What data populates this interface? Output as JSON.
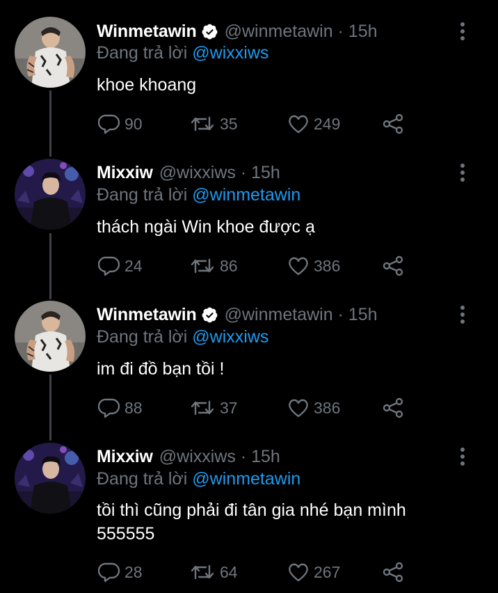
{
  "colors": {
    "background": "#000000",
    "text": "#ffffff",
    "secondary": "#6e767d",
    "link": "#1d9bf0",
    "verified": "#ffffff",
    "thread_line": "#3d4046"
  },
  "icons": {
    "reply": "reply-icon",
    "retweet": "retweet-icon",
    "like": "heart-icon",
    "share": "share-icon",
    "more": "more-vertical-icon",
    "verified": "verified-badge-icon"
  },
  "tweets": [
    {
      "name": "Winmetawin",
      "verified": true,
      "handle": "@winmetawin · 15h",
      "replying_prefix": "Đang trả lời",
      "replying_to": "@wixxiws",
      "text": "khoe khoang",
      "replies": "90",
      "retweets": "35",
      "likes": "249"
    },
    {
      "name": "Mixxiw",
      "verified": false,
      "handle": "@wixxiws · 15h",
      "replying_prefix": "Đang trả lời",
      "replying_to": "@winmetawin",
      "text": "thách ngài Win khoe được ạ",
      "replies": "24",
      "retweets": "86",
      "likes": "386"
    },
    {
      "name": "Winmetawin",
      "verified": true,
      "handle": "@winmetawin · 15h",
      "replying_prefix": "Đang trả lời",
      "replying_to": "@wixxiws",
      "text": "im đi đồ bạn tồi !",
      "replies": "88",
      "retweets": "37",
      "likes": "386"
    },
    {
      "name": "Mixxiw",
      "verified": false,
      "handle": "@wixxiws · 15h",
      "replying_prefix": "Đang trả lời",
      "replying_to": "@winmetawin",
      "text_line1": "tồi thì cũng phải đi tân gia nhé bạn mình",
      "text_line2": "555555",
      "replies": "28",
      "retweets": "64",
      "likes": "267"
    }
  ]
}
